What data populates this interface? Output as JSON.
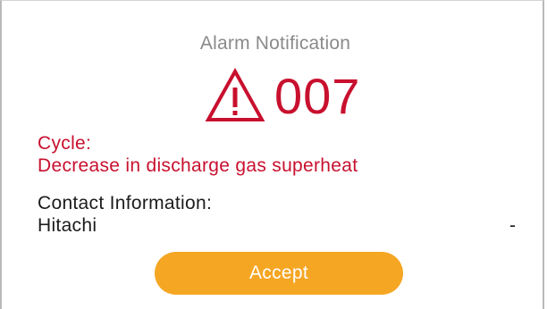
{
  "dialog": {
    "title": "Alarm Notification",
    "alarm": {
      "icon": "warning-triangle-icon",
      "code": "007",
      "color": "#c8102e"
    },
    "cycle": {
      "label": "Cycle:",
      "description": "Decrease in discharge gas superheat"
    },
    "contact": {
      "label": "Contact Information:",
      "name": "Hitachi",
      "value": "-"
    },
    "accept_button": {
      "label": "Accept",
      "color": "#f5a623"
    }
  }
}
